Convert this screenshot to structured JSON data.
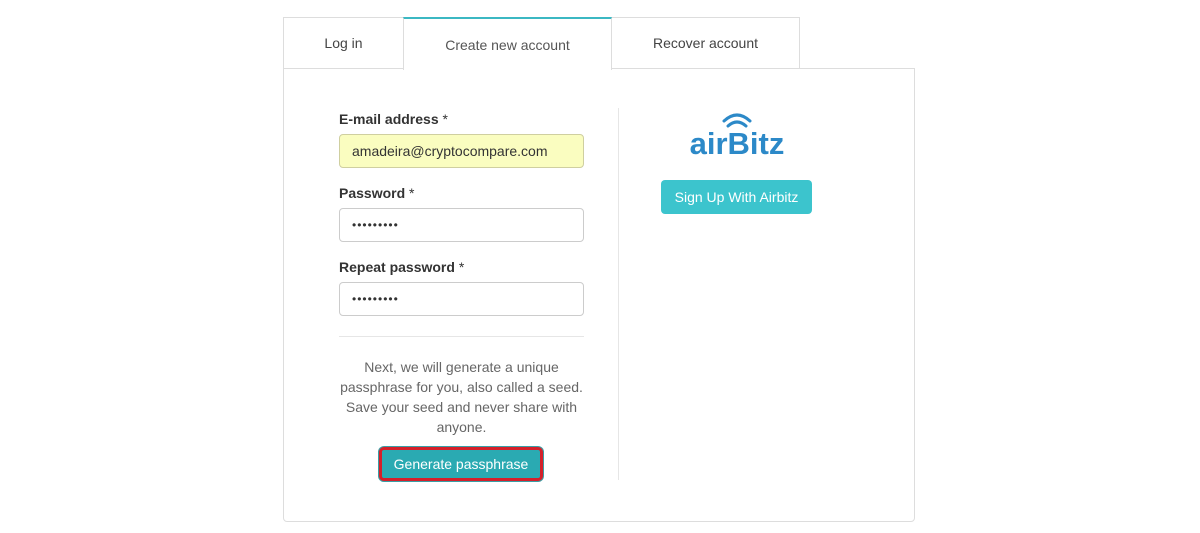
{
  "tabs": {
    "login": "Log in",
    "create": "Create new account",
    "recover": "Recover account"
  },
  "form": {
    "email_label": "E-mail address",
    "email_value": "amadeira@cryptocompare.com",
    "password_label": "Password",
    "password_value": "•••••••••",
    "repeat_label": "Repeat password",
    "repeat_value": "•••••••••",
    "required_mark": "*"
  },
  "info_text": "Next, we will generate a unique passphrase for you, also called a seed. Save your seed and never share with anyone.",
  "generate_button": "Generate passphrase",
  "airbitz": {
    "logo_text": "airBitz",
    "button": "Sign Up With Airbitz",
    "brand_color": "#2c89c8",
    "button_color": "#3cc4cd"
  },
  "colors": {
    "accent": "#2aaab2",
    "highlight_border": "#d4202a",
    "autofill_bg": "#fafdc0"
  }
}
